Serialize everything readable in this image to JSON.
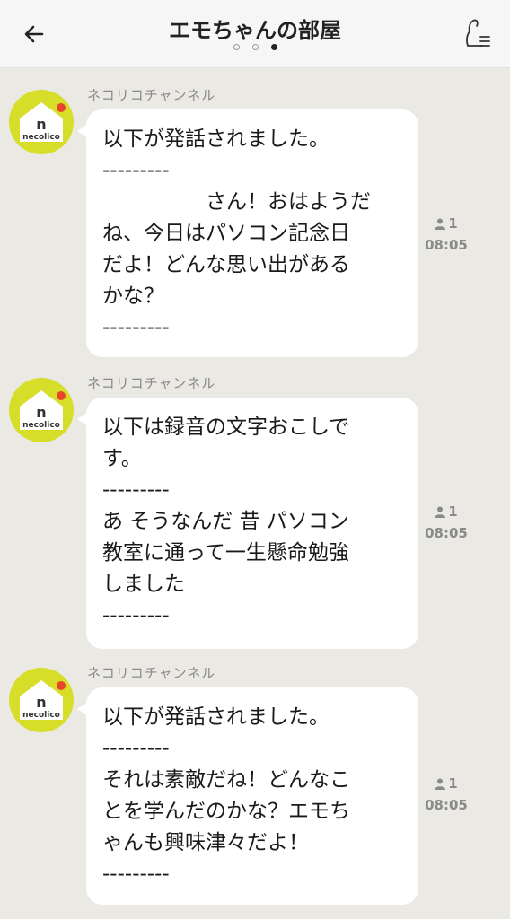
{
  "header": {
    "title": "エモちゃんの部屋"
  },
  "messages": [
    {
      "sender": "ネコリコチャンネル",
      "avatar_text": "necolico",
      "avatar_letter": "n",
      "lines": [
        "以下が発話されました。",
        "---------",
        "　　　　　さん！おはようだ",
        "ね、今日はパソコン記念日",
        "だよ！どんな思い出がある",
        "かな？",
        "---------"
      ],
      "read_count": "1",
      "time": "08:05"
    },
    {
      "sender": "ネコリコチャンネル",
      "avatar_text": "necolico",
      "avatar_letter": "n",
      "lines": [
        "以下は録音の文字おこしで",
        "す。",
        "---------",
        "あ そうなんだ 昔 パソコン",
        "教室に通って一生懸命勉強",
        "しました",
        "---------"
      ],
      "read_count": "1",
      "time": "08:05"
    },
    {
      "sender": "ネコリコチャンネル",
      "avatar_text": "necolico",
      "avatar_letter": "n",
      "lines": [
        "以下が発話されました。",
        "---------",
        "それは素敵だね！どんなこ",
        "とを学んだのかな？エモち",
        "ゃんも興味津々だよ！",
        "---------"
      ],
      "read_count": "1",
      "time": "08:05"
    }
  ],
  "colors": {
    "background": "#ebe9e4",
    "avatar": "#d6de2a",
    "bubble": "#ffffff"
  }
}
